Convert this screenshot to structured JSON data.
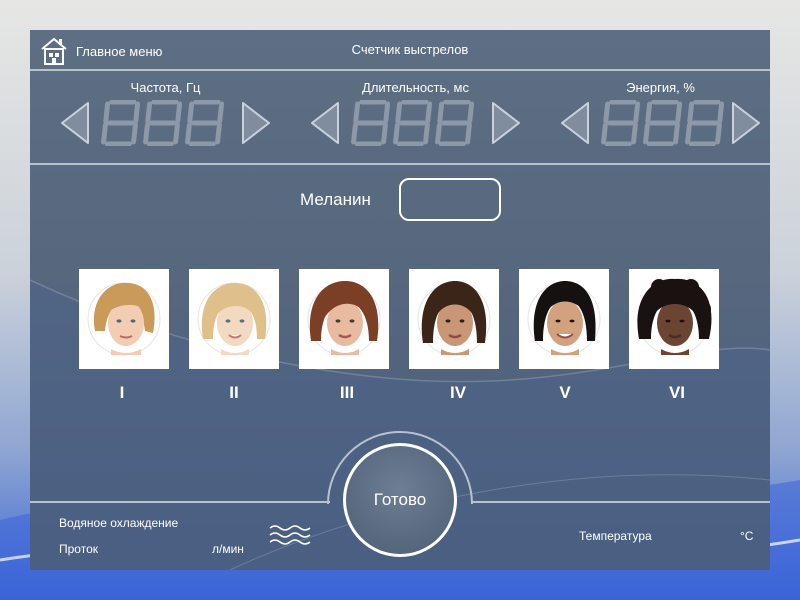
{
  "header": {
    "home_label": "Главное меню",
    "counter_title": "Счетчик выстрелов"
  },
  "controls": [
    {
      "label": "Частота, Гц",
      "display": "888"
    },
    {
      "label": "Длительность, мс",
      "display": "888"
    },
    {
      "label": "Энергия, %",
      "display": "888"
    }
  ],
  "melanin": {
    "label": "Меланин",
    "value": ""
  },
  "skin_types": [
    {
      "numeral": "I"
    },
    {
      "numeral": "II"
    },
    {
      "numeral": "III"
    },
    {
      "numeral": "IV"
    },
    {
      "numeral": "V"
    },
    {
      "numeral": "VI"
    }
  ],
  "bottom": {
    "water_cooling_label": "Водяное охлаждение",
    "flow_label": "Проток",
    "flow_unit": "л/мин",
    "ready_label": "Готово",
    "temperature_label": "Температура",
    "temperature_unit": "°C"
  },
  "icons": {
    "home": "home-icon",
    "arrow_left": "arrow-left-icon",
    "arrow_right": "arrow-right-icon",
    "water": "water-waves-icon"
  },
  "colors": {
    "panel": "#56677e",
    "accent": "#ffffff",
    "digit_ghost": "#8d99a8"
  }
}
